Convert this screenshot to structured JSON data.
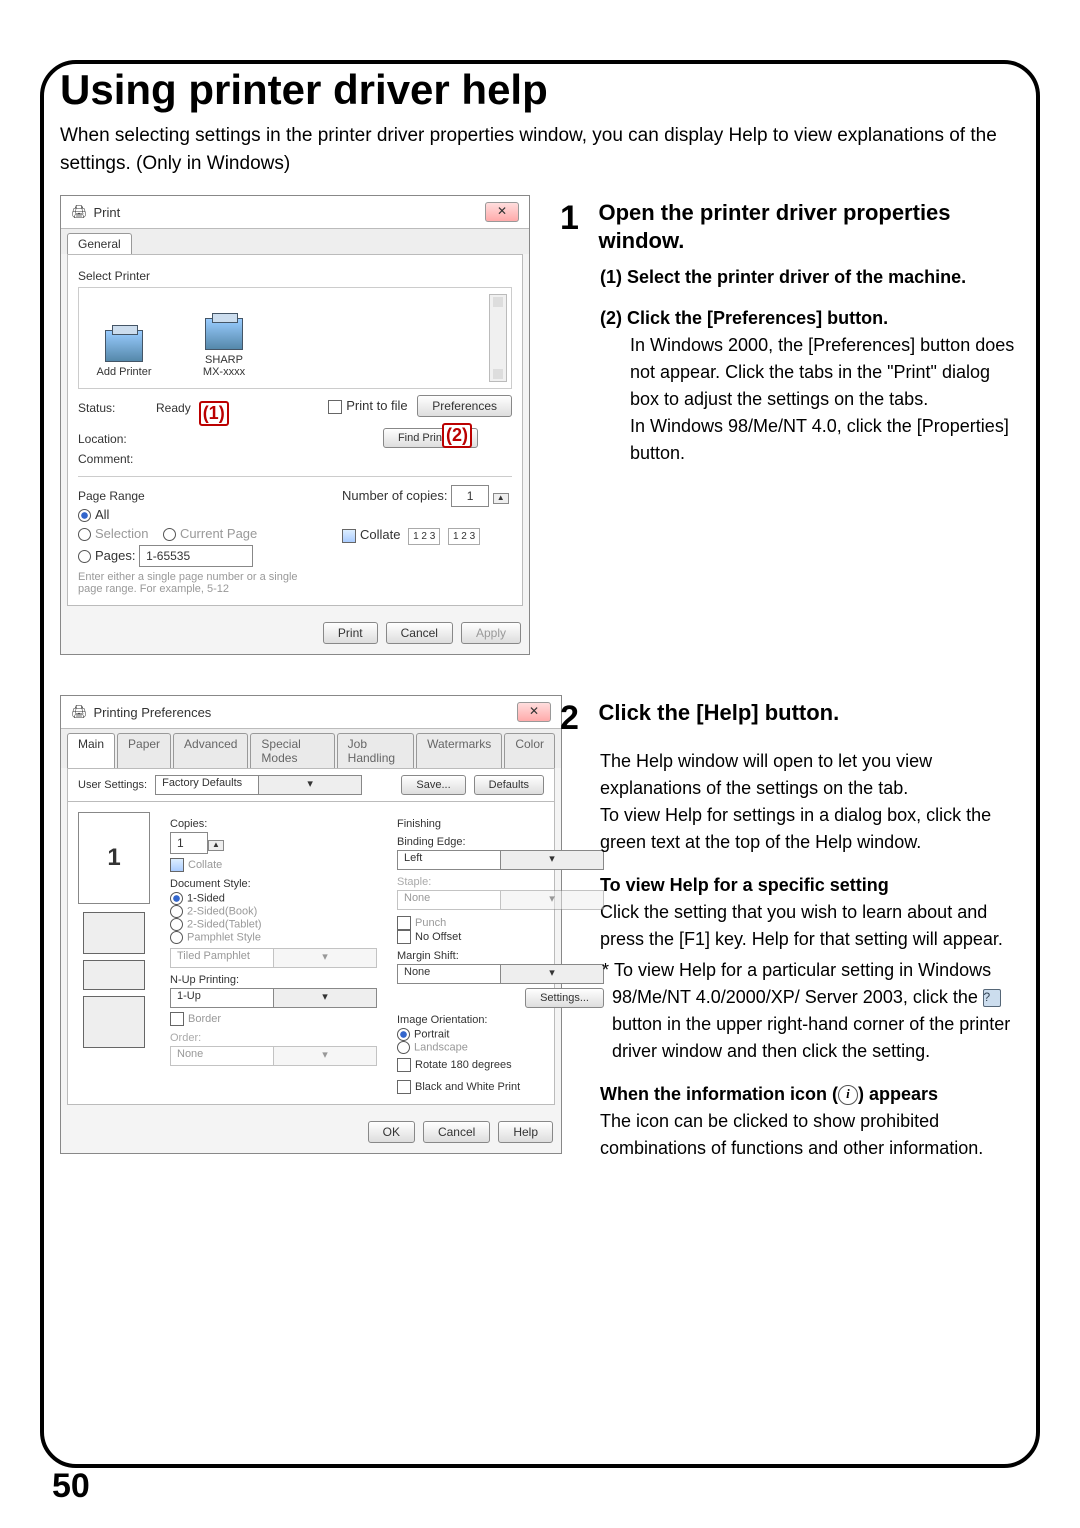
{
  "page_number": "50",
  "heading": "Using printer driver help",
  "intro": "When selecting settings in the printer driver properties window, you can display Help to view explanations of the settings. (Only in Windows)",
  "step1": {
    "no": "1",
    "title": "Open the printer driver properties window.",
    "sub1_no": "(1)",
    "sub1_head": "Select the printer driver of the machine.",
    "sub2_no": "(2)",
    "sub2_head": "Click the [Preferences] button.",
    "sub2_body_a": "In Windows 2000, the [Preferences] button does not appear. Click the tabs in the \"Print\" dialog box to adjust the settings on the tabs.",
    "sub2_body_b": "In Windows 98/Me/NT 4.0, click the [Properties] button."
  },
  "step2": {
    "no": "2",
    "title": "Click the [Help] button.",
    "body_a": "The Help window will open to let you view explanations of the settings on the tab.",
    "body_b": "To view Help for settings in a dialog box, click the green text at the top of the Help window.",
    "sub_head": "To view Help for a specific setting",
    "sub_body": "Click the setting that you wish to learn about and press the [F1] key. Help for that setting will appear.",
    "note_a": "To view Help for a particular setting in Windows 98/Me/NT 4.0/2000/XP/ Server 2003, click the ",
    "note_b": " button in the upper right-hand corner of the printer driver window and then click the setting.",
    "info_head_a": "When the information icon (",
    "info_head_b": ") appears",
    "info_body": "The icon can be clicked to show prohibited combinations of functions and other information."
  },
  "print_dialog": {
    "title": "Print",
    "tab_general": "General",
    "select_printer": "Select Printer",
    "add_printer": "Add Printer",
    "printer_name": "SHARP",
    "printer_model": "MX-xxxx",
    "status_lbl": "Status:",
    "status_val": "Ready",
    "location_lbl": "Location:",
    "comment_lbl": "Comment:",
    "mark1": "(1)",
    "print_to_file": "Print to file",
    "preferences_btn": "Preferences",
    "find_btn": "Find Printer...",
    "mark2": "(2)",
    "page_range": "Page Range",
    "all": "All",
    "selection": "Selection",
    "current": "Current Page",
    "pages": "Pages:",
    "pages_val": "1-65535",
    "pages_hint": "Enter either a single page number or a single page range.  For example, 5-12",
    "copies_lbl": "Number of copies:",
    "copies_val": "1",
    "collate": "Collate",
    "coll_ico": "1 2 3",
    "btn_print": "Print",
    "btn_cancel": "Cancel",
    "btn_apply": "Apply"
  },
  "prefs_dialog": {
    "title": "Printing Preferences",
    "tabs": {
      "main": "Main",
      "paper": "Paper",
      "advanced": "Advanced",
      "special": "Special Modes",
      "job": "Job Handling",
      "water": "Watermarks",
      "color": "Color"
    },
    "user_settings": "User Settings:",
    "user_val": "Factory Defaults",
    "save": "Save...",
    "defaults": "Defaults",
    "thumb_no": "1",
    "copies": "Copies:",
    "copies_val": "1",
    "collate": "Collate",
    "docstyle": "Document Style:",
    "ds1": "1-Sided",
    "ds2": "2-Sided(Book)",
    "ds3": "2-Sided(Tablet)",
    "ds4": "Pamphlet Style",
    "tiled": "Tiled Pamphlet",
    "nup": "N-Up Printing:",
    "nup_val": "1-Up",
    "border": "Border",
    "order": "Order:",
    "order_val": "None",
    "finishing": "Finishing",
    "binding": "Binding Edge:",
    "binding_val": "Left",
    "staple_lbl": "Staple:",
    "staple_val": "None",
    "punch": "Punch",
    "nooffset": "No Offset",
    "margin": "Margin Shift:",
    "margin_val": "None",
    "settings_btn": "Settings...",
    "orient": "Image Orientation:",
    "portrait": "Portrait",
    "landscape": "Landscape",
    "rotate": "Rotate 180 degrees",
    "bw": "Black and White Print",
    "ok": "OK",
    "cancel": "Cancel",
    "help": "Help"
  }
}
